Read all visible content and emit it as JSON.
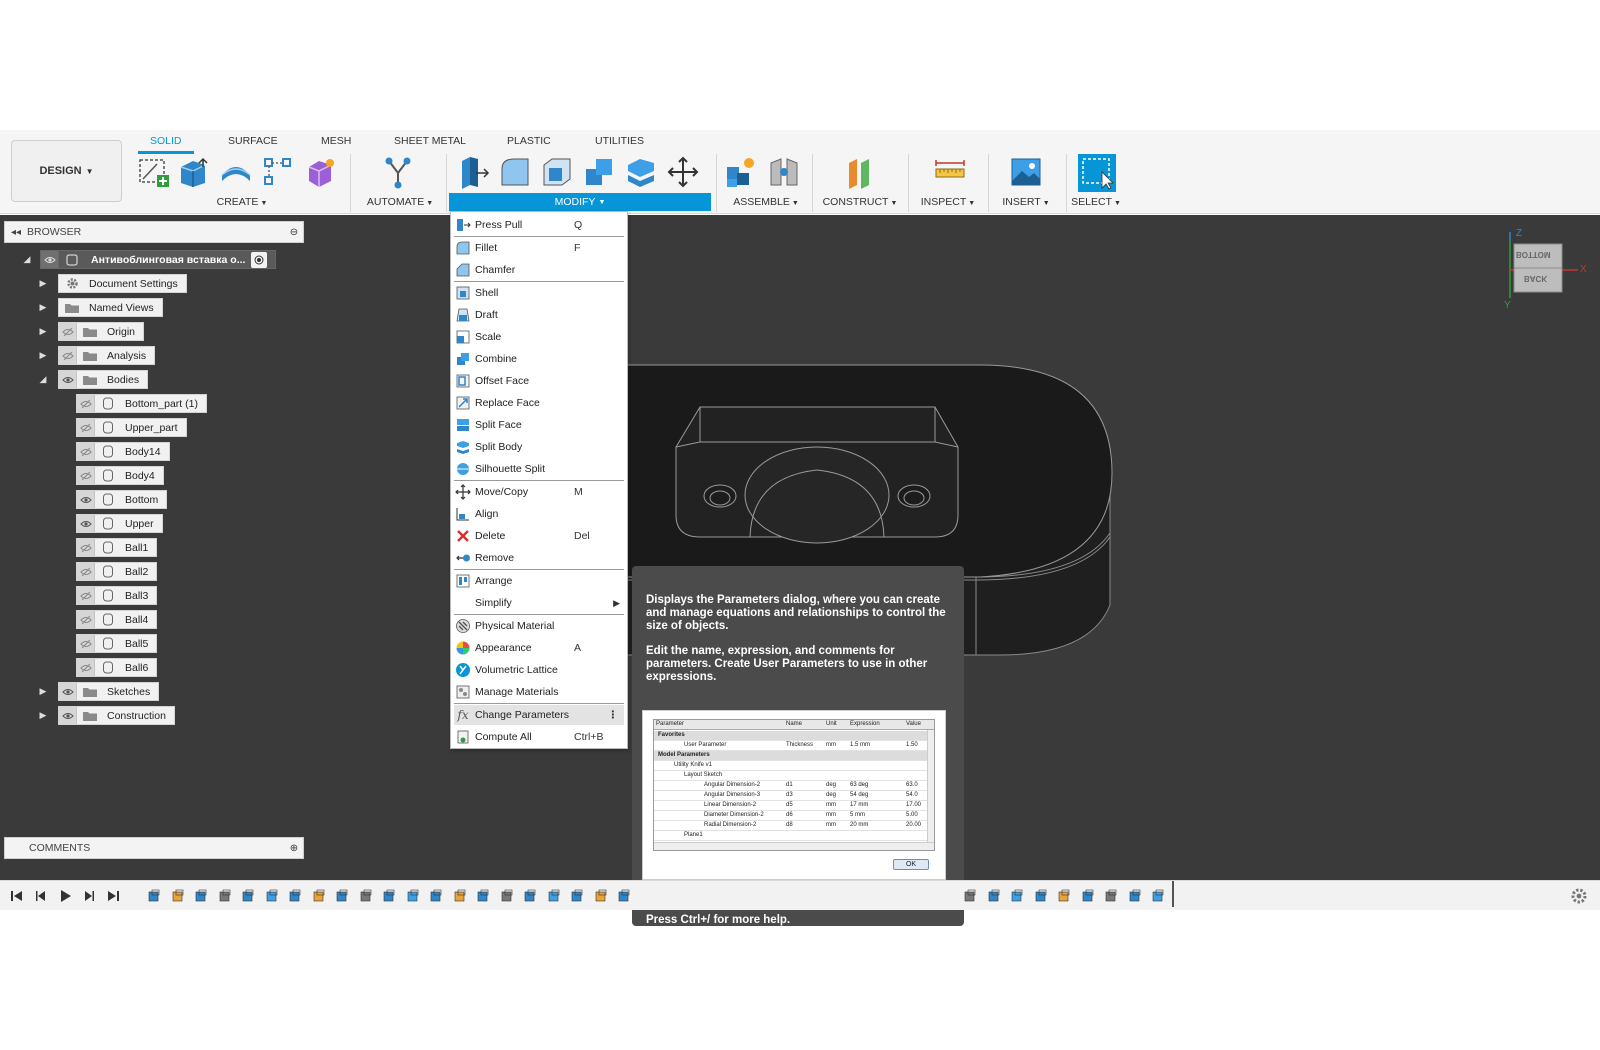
{
  "workspace": {
    "label": "DESIGN"
  },
  "tabs": [
    {
      "label": "SOLID",
      "active": true
    },
    {
      "label": "SURFACE"
    },
    {
      "label": "MESH"
    },
    {
      "label": "SHEET METAL"
    },
    {
      "label": "PLASTIC"
    },
    {
      "label": "UTILITIES"
    }
  ],
  "toolbar_groups": {
    "create": "CREATE",
    "automate": "AUTOMATE",
    "modify": "MODIFY",
    "assemble": "ASSEMBLE",
    "construct": "CONSTRUCT",
    "inspect": "INSPECT",
    "insert": "INSERT",
    "select": "SELECT"
  },
  "browser": {
    "title": "BROWSER",
    "root": "Антивоблинговая вставка о...",
    "nodes": [
      {
        "label": "Document Settings",
        "icon": "gear-icon"
      },
      {
        "label": "Named Views",
        "icon": "folder-icon"
      },
      {
        "label": "Origin",
        "icon": "folder-icon",
        "visible": false
      },
      {
        "label": "Analysis",
        "icon": "folder-icon",
        "visible": false
      },
      {
        "label": "Bodies",
        "icon": "folder-icon",
        "visible": true
      }
    ],
    "bodies": [
      {
        "label": "Bottom_part (1)",
        "visible": false
      },
      {
        "label": "Upper_part",
        "visible": false
      },
      {
        "label": "Body14",
        "visible": false
      },
      {
        "label": "Body4",
        "visible": false
      },
      {
        "label": "Bottom",
        "visible": true
      },
      {
        "label": "Upper",
        "visible": true
      },
      {
        "label": "Ball1",
        "visible": false
      },
      {
        "label": "Ball2",
        "visible": false
      },
      {
        "label": "Ball3",
        "visible": false
      },
      {
        "label": "Ball4",
        "visible": false
      },
      {
        "label": "Ball5",
        "visible": false
      },
      {
        "label": "Ball6",
        "visible": false
      }
    ],
    "tail": [
      {
        "label": "Sketches",
        "visible": true
      },
      {
        "label": "Construction",
        "visible": true
      }
    ]
  },
  "comments": {
    "title": "COMMENTS"
  },
  "viewcube": {
    "face_top": "BOTTOM",
    "face_front": "BACK",
    "axis_x": "X",
    "axis_y": "Y",
    "axis_z": "Z"
  },
  "modify_menu": {
    "items": [
      {
        "label": "Press Pull",
        "shortcut": "Q",
        "icon": "press-pull-icon"
      },
      {
        "label": "Fillet",
        "shortcut": "F",
        "icon": "fillet-icon"
      },
      {
        "label": "Chamfer",
        "shortcut": "",
        "icon": "chamfer-icon"
      },
      {
        "label": "Shell",
        "shortcut": "",
        "icon": "shell-icon"
      },
      {
        "label": "Draft",
        "shortcut": "",
        "icon": "draft-icon"
      },
      {
        "label": "Scale",
        "shortcut": "",
        "icon": "scale-icon"
      },
      {
        "label": "Combine",
        "shortcut": "",
        "icon": "combine-icon"
      },
      {
        "label": "Offset Face",
        "shortcut": "",
        "icon": "offset-face-icon"
      },
      {
        "label": "Replace Face",
        "shortcut": "",
        "icon": "replace-face-icon"
      },
      {
        "label": "Split Face",
        "shortcut": "",
        "icon": "split-face-icon"
      },
      {
        "label": "Split Body",
        "shortcut": "",
        "icon": "split-body-icon"
      },
      {
        "label": "Silhouette Split",
        "shortcut": "",
        "icon": "silhouette-split-icon"
      },
      {
        "label": "Move/Copy",
        "shortcut": "M",
        "icon": "move-icon"
      },
      {
        "label": "Align",
        "shortcut": "",
        "icon": "align-icon"
      },
      {
        "label": "Delete",
        "shortcut": "Del",
        "icon": "delete-icon"
      },
      {
        "label": "Remove",
        "shortcut": "",
        "icon": "remove-icon"
      },
      {
        "label": "Arrange",
        "shortcut": "",
        "icon": "arrange-icon"
      },
      {
        "label": "Simplify",
        "shortcut": "",
        "icon": "submenu-arrow-icon"
      },
      {
        "label": "Physical Material",
        "shortcut": "",
        "icon": "physical-material-icon"
      },
      {
        "label": "Appearance",
        "shortcut": "A",
        "icon": "appearance-icon"
      },
      {
        "label": "Volumetric Lattice",
        "shortcut": "",
        "icon": "lattice-icon"
      },
      {
        "label": "Manage Materials",
        "shortcut": "",
        "icon": "manage-materials-icon"
      },
      {
        "label": "Change Parameters",
        "shortcut": "",
        "icon": "fx-icon"
      },
      {
        "label": "Compute All",
        "shortcut": "Ctrl+B",
        "icon": "compute-icon"
      }
    ]
  },
  "tooltip": {
    "para1": "Displays the Parameters dialog, where you can create and manage equations and relationships to control the size of objects.",
    "para2": "Edit the name, expression, and comments for parameters. Create User Parameters to use in other expressions.",
    "more": "Press Ctrl+/ for more help.",
    "table": {
      "headers": [
        "Parameter",
        "Name",
        "Unit",
        "Expression",
        "Value"
      ],
      "rows": [
        [
          "Favorites",
          "",
          "",
          "",
          ""
        ],
        [
          "User Parameter",
          "Thickness",
          "mm",
          "1.5 mm",
          "1.50"
        ],
        [
          "Model Parameters",
          "",
          "",
          "",
          ""
        ],
        [
          "Utility Knife v1",
          "",
          "",
          "",
          ""
        ],
        [
          "Layout Sketch",
          "",
          "",
          "",
          ""
        ],
        [
          "Angular Dimension-2",
          "d1",
          "deg",
          "63 deg",
          "63.0"
        ],
        [
          "Angular Dimension-3",
          "d3",
          "deg",
          "54 deg",
          "54.0"
        ],
        [
          "Linear Dimension-2",
          "d5",
          "mm",
          "17 mm",
          "17.00"
        ],
        [
          "Diameter Dimension-2",
          "d6",
          "mm",
          "5 mm",
          "5.00"
        ],
        [
          "Radial Dimension-2",
          "d8",
          "mm",
          "20 mm",
          "20.00"
        ],
        [
          "Plane1",
          "",
          "",
          "",
          ""
        ]
      ],
      "ok": "OK"
    }
  },
  "colors": {
    "accent": "#0696d7",
    "viewport": "#3a3a3a",
    "tooltip": "#4b4b4b"
  }
}
